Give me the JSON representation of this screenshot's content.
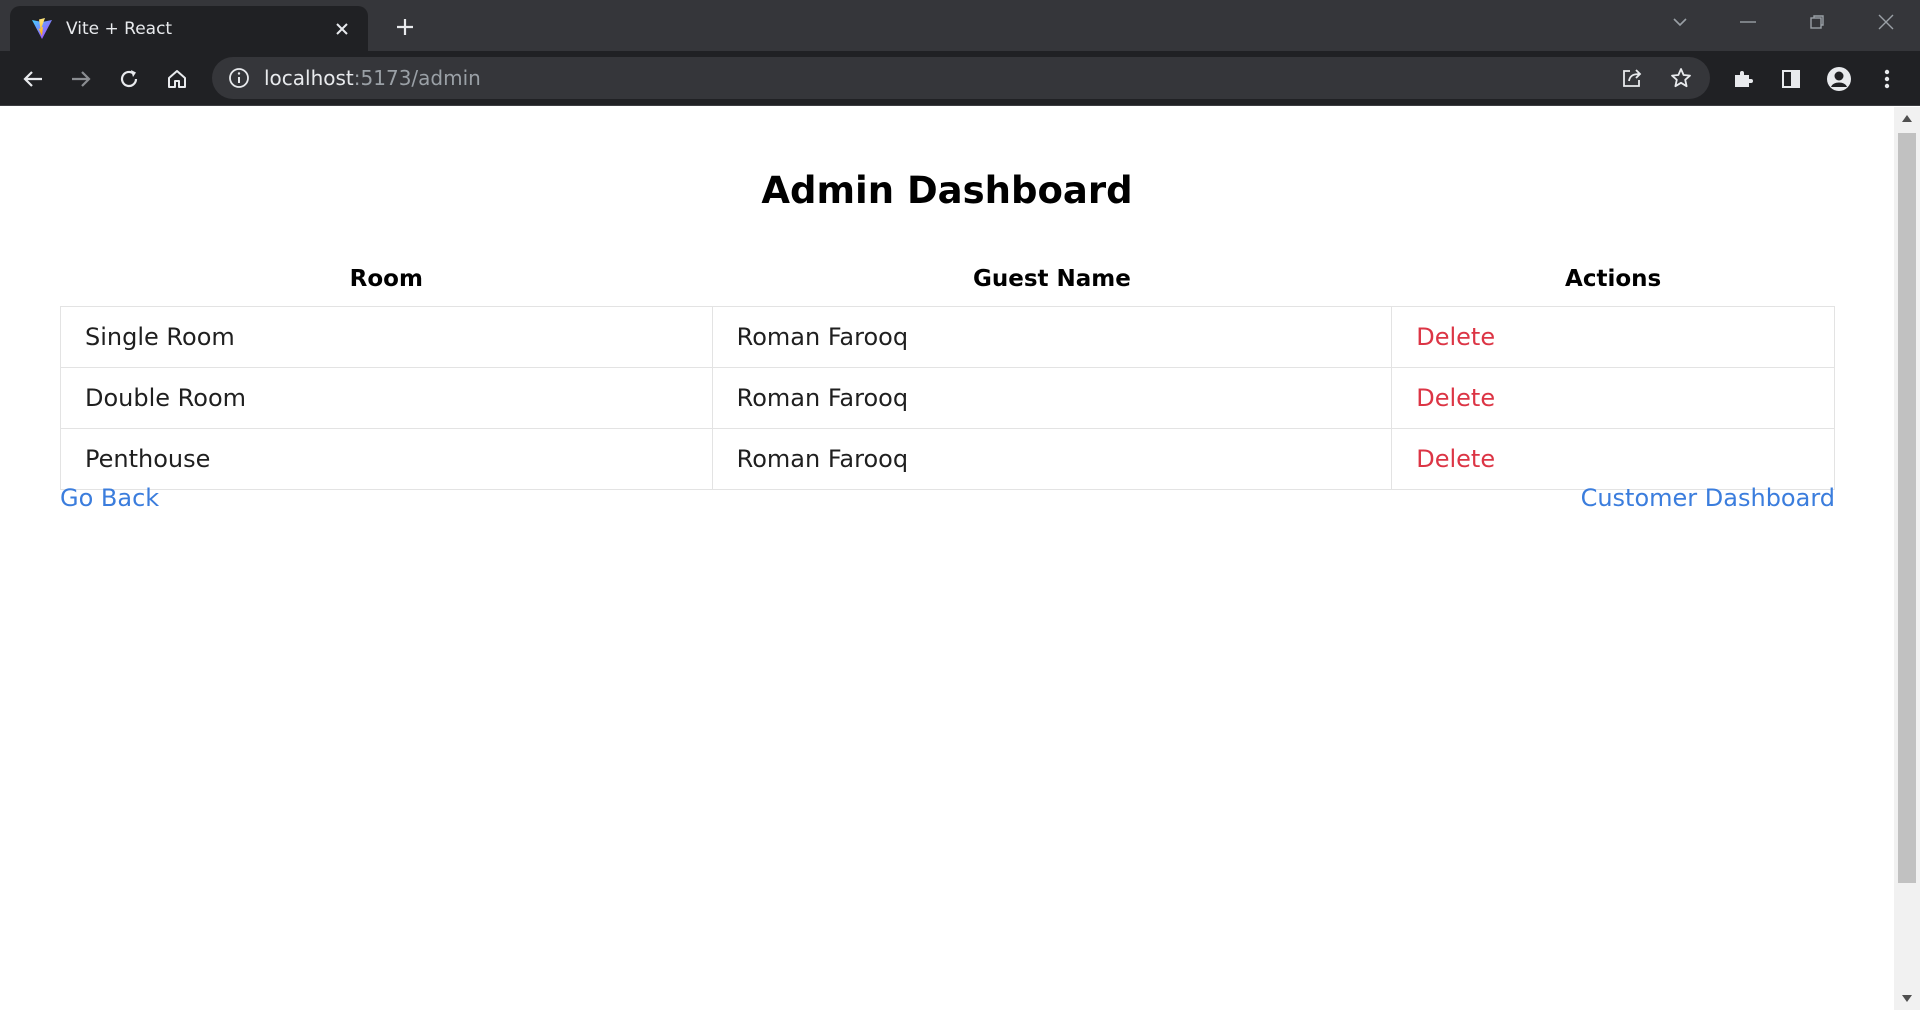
{
  "browser": {
    "tab_title": "Vite + React",
    "url_host": "localhost",
    "url_path": ":5173/admin"
  },
  "page": {
    "title": "Admin Dashboard",
    "table": {
      "headers": [
        "Room",
        "Guest Name",
        "Actions"
      ],
      "rows": [
        {
          "room": "Single Room",
          "guest": "Roman Farooq",
          "action": "Delete"
        },
        {
          "room": "Double Room",
          "guest": "Roman Farooq",
          "action": "Delete"
        },
        {
          "room": "Penthouse",
          "guest": "Roman Farooq",
          "action": "Delete"
        }
      ]
    },
    "links": {
      "go_back": "Go Back",
      "customer_dashboard": "Customer Dashboard"
    }
  },
  "colors": {
    "delete": "#dc3545",
    "link": "#3b7ddd"
  }
}
